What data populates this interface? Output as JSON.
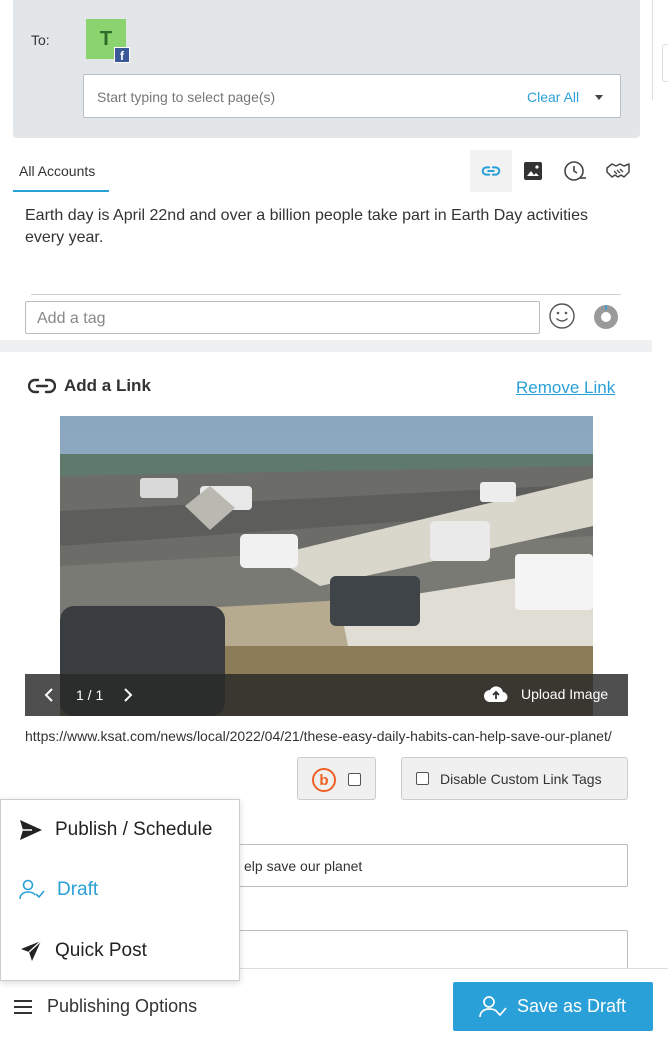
{
  "recipients": {
    "to_label": "To:",
    "avatar_letter": "T",
    "network_badge": "f",
    "placeholder": "Start typing to select page(s)",
    "clear_all": "Clear All"
  },
  "composer": {
    "tab_label": "All Accounts",
    "tool_icons": [
      "link-icon",
      "image-icon",
      "schedule-icon",
      "handshake-icon"
    ],
    "message": "Earth day is April 22nd and over a billion people take part in Earth Day activities every year.",
    "tag_placeholder": "Add a tag"
  },
  "link_card": {
    "title": "Add a Link",
    "remove_label": "Remove Link",
    "image_counter": "1 / 1",
    "upload_label": "Upload Image",
    "url": "https://www.ksat.com/news/local/2022/04/21/these-easy-daily-habits-can-help-save-our-planet/",
    "bitly_letter": "b",
    "disable_tags_label": "Disable Custom Link Tags",
    "title_field_value": "elp save our planet"
  },
  "publish_menu": {
    "items": [
      {
        "label": "Publish / Schedule",
        "icon": "send-icon",
        "selected": false
      },
      {
        "label": "Draft",
        "icon": "user-check-icon",
        "selected": true
      },
      {
        "label": "Quick Post",
        "icon": "paper-plane-icon",
        "selected": false
      }
    ]
  },
  "footer": {
    "options_label": "Publishing Options",
    "save_label": "Save as Draft"
  },
  "colors": {
    "accent": "#2aa0d8",
    "panel_bg": "#e3e6e8",
    "avatar_bg": "#8bd36e",
    "facebook": "#3b5998",
    "bitly": "#ee6123"
  }
}
